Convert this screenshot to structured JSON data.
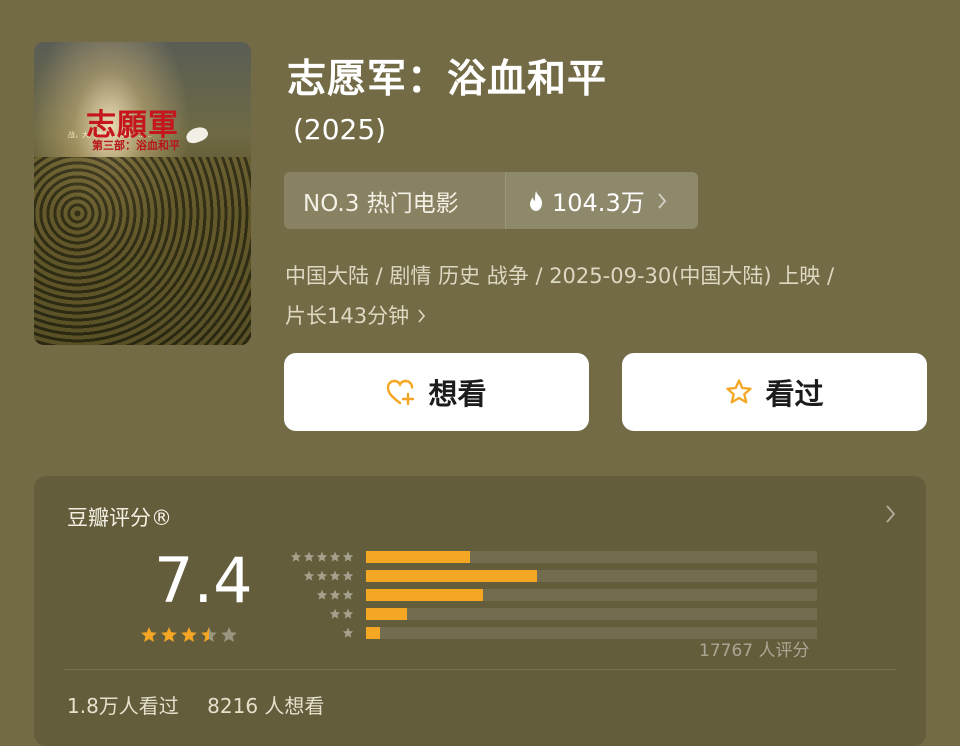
{
  "movie": {
    "title": "志愿军：浴血和平",
    "year": "(2025)",
    "poster": {
      "title_text": "志願軍",
      "subtitle_text": "第三部：浴血和平",
      "tagline_text": "战，大门敞开……打，……"
    },
    "rank_label": "NO.3 热门电影",
    "hot_count": "104.3万",
    "meta_line1": "中国大陆 / 剧情 历史 战争 / 2025-09-30(中国大陆) 上映 /",
    "meta_line2": "片长143分钟"
  },
  "actions": {
    "want_label": "想看",
    "seen_label": "看过"
  },
  "rating": {
    "header": "豆瓣评分®",
    "score": "7.4",
    "stars": 3.5,
    "distribution": [
      {
        "stars": 5,
        "fraction": 0.23
      },
      {
        "stars": 4,
        "fraction": 0.38
      },
      {
        "stars": 3,
        "fraction": 0.26
      },
      {
        "stars": 2,
        "fraction": 0.09
      },
      {
        "stars": 1,
        "fraction": 0.03
      }
    ],
    "raters": "17767 人评分",
    "seen_count": "1.8万人看过",
    "want_count": "8216 人想看"
  },
  "colors": {
    "background": "#736b45",
    "accent": "#f5a623",
    "star_empty": "#9a9680"
  },
  "icons": [
    "flame-icon",
    "chevron-right-icon",
    "heart-plus-icon",
    "star-icon"
  ]
}
